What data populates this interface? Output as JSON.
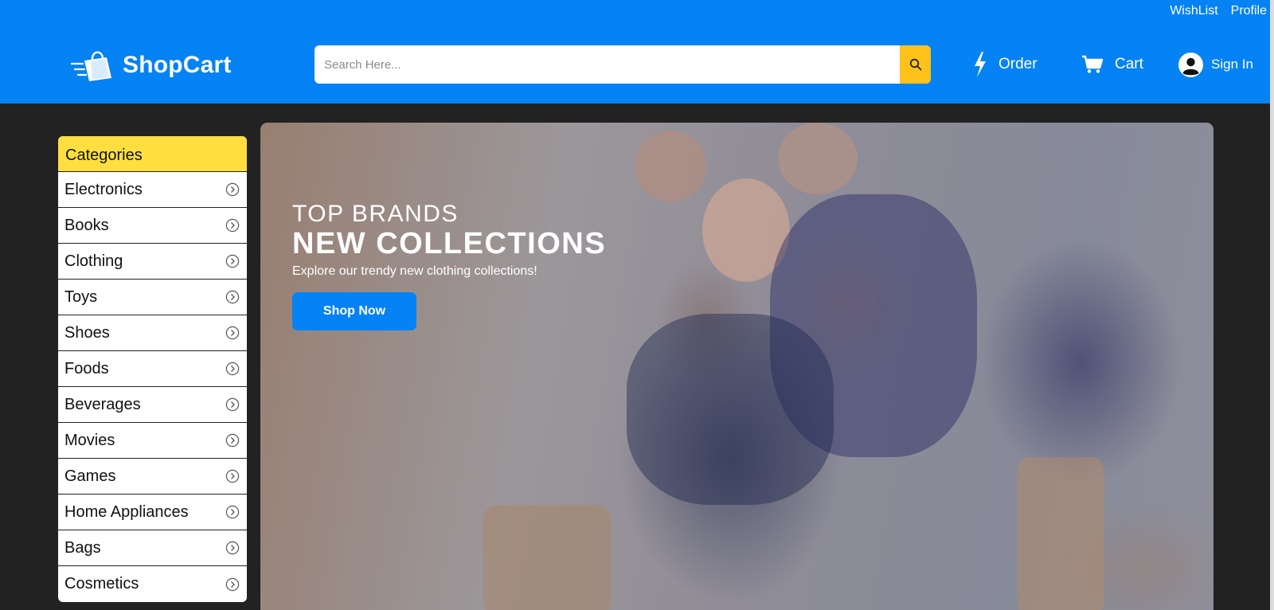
{
  "top_links": {
    "wishlist": "WishList",
    "profile": "Profile"
  },
  "brand": {
    "name": "ShopCart",
    "icon": "shopping-bag-icon"
  },
  "search": {
    "placeholder": "Search Here...",
    "value": "",
    "icon": "search-icon"
  },
  "nav": {
    "order": {
      "label": "Order",
      "icon": "bolt-icon"
    },
    "cart": {
      "label": "Cart",
      "icon": "cart-icon"
    },
    "signin": {
      "label": "Sign In",
      "icon": "user-icon"
    }
  },
  "categories": {
    "title": "Categories",
    "items": [
      {
        "label": "Electronics"
      },
      {
        "label": "Books"
      },
      {
        "label": "Clothing"
      },
      {
        "label": "Toys"
      },
      {
        "label": "Shoes"
      },
      {
        "label": "Foods"
      },
      {
        "label": "Beverages"
      },
      {
        "label": "Movies"
      },
      {
        "label": "Games"
      },
      {
        "label": "Home Appliances"
      },
      {
        "label": "Bags"
      },
      {
        "label": "Cosmetics"
      }
    ]
  },
  "banner": {
    "eyebrow": "TOP BRANDS",
    "headline": "NEW COLLECTIONS",
    "subtitle": "Explore our trendy new clothing collections!",
    "cta": "Shop Now"
  },
  "colors": {
    "primary": "#0582f3",
    "accent": "#ffc21a",
    "category_header": "#ffdf3f",
    "page_bg": "#222222"
  }
}
